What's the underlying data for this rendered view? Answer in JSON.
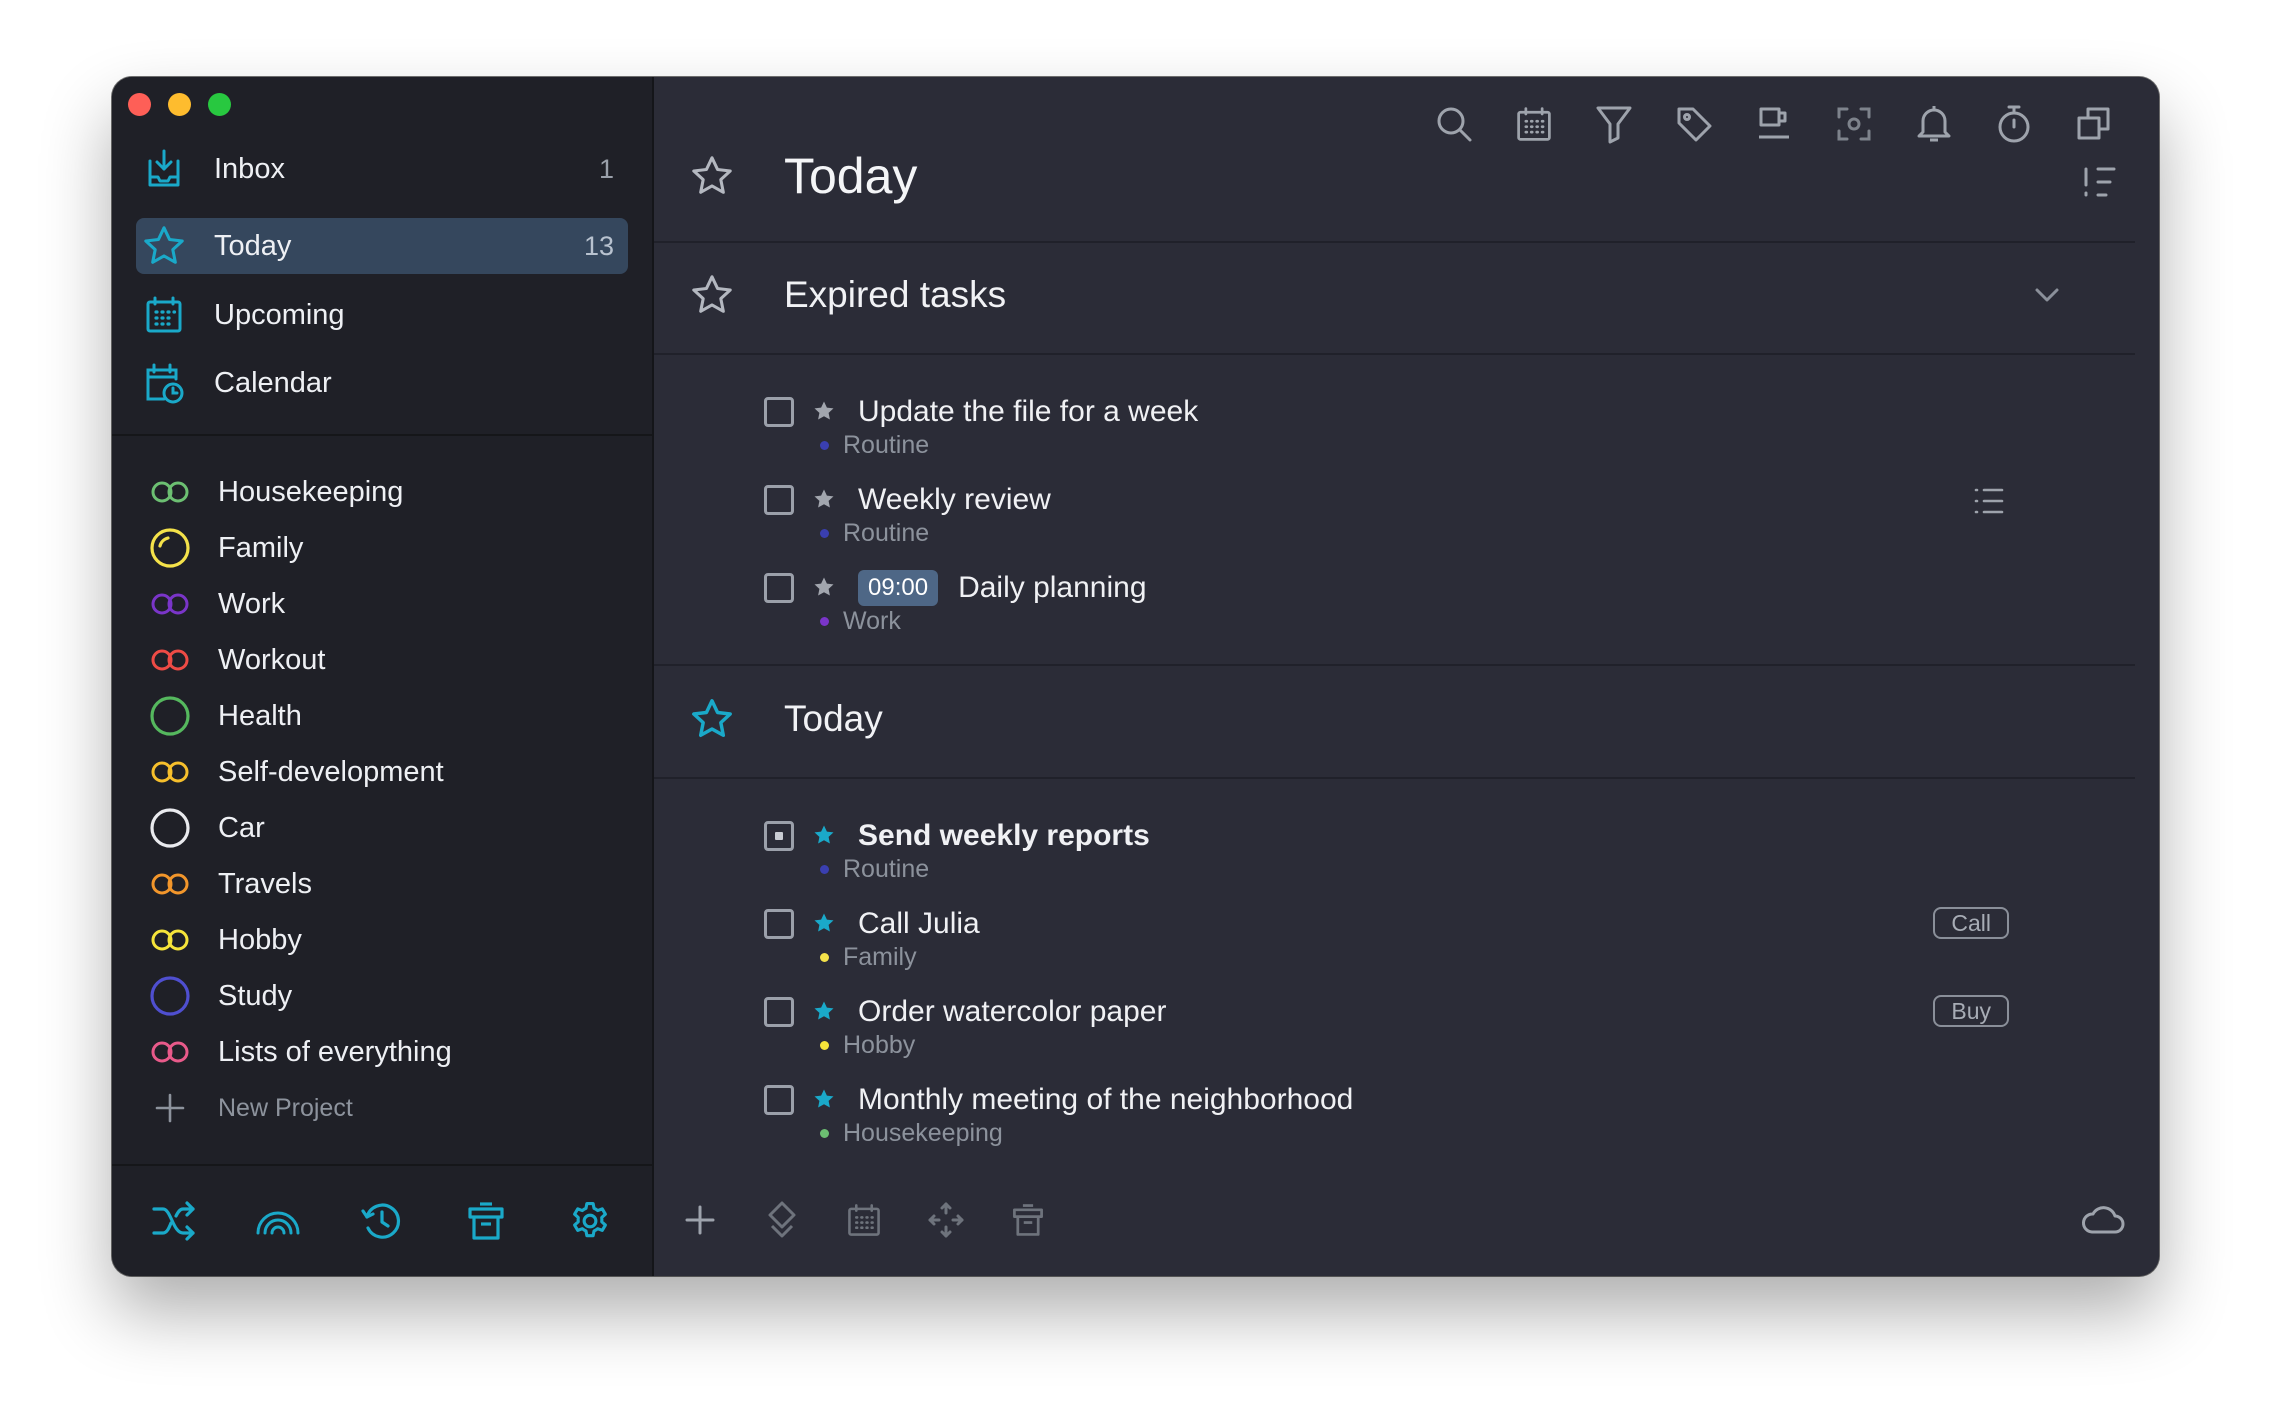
{
  "colors": {
    "accent": "#1aa9c9",
    "sidebar_bg": "#1f2027",
    "main_bg": "#2b2c37",
    "active_item": "#35475d"
  },
  "sidebar": {
    "nav": [
      {
        "label": "Inbox",
        "count": "1",
        "icon": "inbox-tray-icon"
      },
      {
        "label": "Today",
        "count": "13",
        "icon": "star-icon",
        "active": true
      },
      {
        "label": "Upcoming",
        "count": "",
        "icon": "calendar-grid-icon"
      },
      {
        "label": "Calendar",
        "count": "",
        "icon": "calendar-clock-icon"
      }
    ],
    "projects": [
      {
        "label": "Housekeeping",
        "color": "#6cbf72",
        "icon": "double-ring-icon"
      },
      {
        "label": "Family",
        "color": "#f4e24a",
        "icon": "progress-circle-icon"
      },
      {
        "label": "Work",
        "color": "#7a35c9",
        "icon": "double-ring-icon"
      },
      {
        "label": "Workout",
        "color": "#ef4b45",
        "icon": "double-ring-icon"
      },
      {
        "label": "Health",
        "color": "#55b85e",
        "icon": "circle-icon"
      },
      {
        "label": "Self-development",
        "color": "#f6bf2c",
        "icon": "double-ring-icon"
      },
      {
        "label": "Car",
        "color": "#e9eaee",
        "icon": "circle-icon"
      },
      {
        "label": "Travels",
        "color": "#f2962b",
        "icon": "double-ring-icon"
      },
      {
        "label": "Hobby",
        "color": "#f6e43a",
        "icon": "double-ring-icon"
      },
      {
        "label": "Study",
        "color": "#4f4fd0",
        "icon": "circle-icon"
      },
      {
        "label": "Lists of everything",
        "color": "#e85a8a",
        "icon": "double-ring-icon"
      }
    ],
    "new_project_label": "New Project",
    "bottom_icons": [
      "shuffle-icon",
      "rainbow-icon",
      "history-icon",
      "trash-icon",
      "settings-gear-icon"
    ]
  },
  "main": {
    "title": "Today",
    "toolbar_icons": [
      "search-icon",
      "calendar-icon",
      "filter-icon",
      "tag-icon",
      "coffee-cup-icon",
      "focus-icon",
      "bell-icon",
      "stopwatch-icon",
      "duplicate-window-icon"
    ],
    "sections": [
      {
        "title": "Expired tasks",
        "tasks": [
          {
            "text": "Update the file for a week",
            "project": "Routine",
            "project_color": "#3a3fb0"
          },
          {
            "text": "Weekly review",
            "project": "Routine",
            "project_color": "#3a3fb0"
          },
          {
            "text": "Daily planning",
            "time": "09:00",
            "project": "Work",
            "project_color": "#7a35c9"
          }
        ]
      },
      {
        "title": "Today",
        "tasks": [
          {
            "text": "Send weekly reports",
            "project": "Routine",
            "project_color": "#3a3fb0",
            "status": "in-progress"
          },
          {
            "text": "Call Julia",
            "project": "Family",
            "project_color": "#f4e24a",
            "tag": "Call"
          },
          {
            "text": "Order watercolor paper",
            "project": "Hobby",
            "project_color": "#f6e43a",
            "tag": "Buy"
          },
          {
            "text": "Monthly meeting of the neighborhood",
            "project": "Housekeeping",
            "project_color": "#6cbf72"
          }
        ]
      }
    ],
    "bottom_icons": [
      "add-icon",
      "priority-icon",
      "schedule-icon",
      "move-icon",
      "trash-icon",
      "cloud-sync-icon"
    ]
  }
}
